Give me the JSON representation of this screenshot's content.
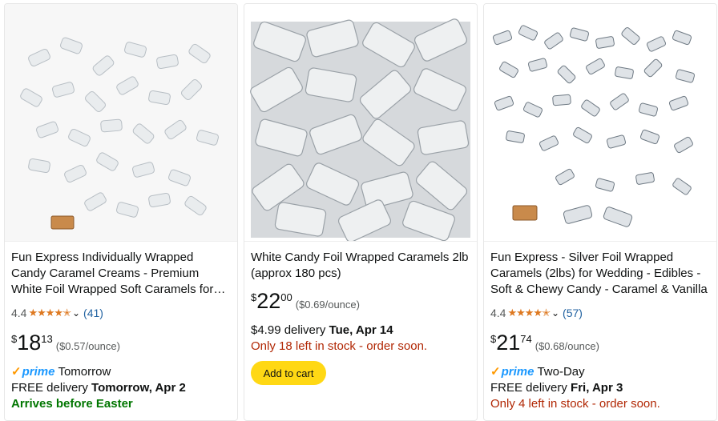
{
  "products": [
    {
      "title": "Fun Express Individually Wrapped Candy Caramel Creams - Premium White Foil Wrapped Soft Caramels for Weddings",
      "rating": "4.4",
      "review_count": "(41)",
      "price_symbol": "$",
      "price_whole": "18",
      "price_fraction": "13",
      "unit_price": "($0.57/ounce)",
      "prime_label": "prime",
      "prime_speed": "Tomorrow",
      "delivery_prefix": "FREE delivery",
      "delivery_date": "Tomorrow, Apr 2",
      "note": "Arrives before Easter"
    },
    {
      "title": "White Candy Foil Wrapped Caramels 2lb (approx 180 pcs)",
      "price_symbol": "$",
      "price_whole": "22",
      "price_fraction": "00",
      "unit_price": "($0.69/ounce)",
      "delivery_prefix": "$4.99 delivery",
      "delivery_date": "Tue, Apr 14",
      "stock": "Only 18 left in stock - order soon.",
      "button": "Add to cart"
    },
    {
      "title": "Fun Express - Silver Foil Wrapped Caramels (2lbs) for Wedding - Edibles - Soft & Chewy Candy - Caramel & Vanilla",
      "rating": "4.4",
      "review_count": "(57)",
      "price_symbol": "$",
      "price_whole": "21",
      "price_fraction": "74",
      "unit_price": "($0.68/ounce)",
      "prime_label": "prime",
      "prime_speed": "Two-Day",
      "delivery_prefix": "FREE delivery",
      "delivery_date": "Fri, Apr 3",
      "stock": "Only 4 left in stock - order soon."
    }
  ],
  "colors": {
    "star": "#de7921",
    "link": "#2162a1",
    "stock_red": "#b12704",
    "green": "#007600",
    "prime_blue": "#1a98ff",
    "cart_yellow": "#ffd814"
  }
}
